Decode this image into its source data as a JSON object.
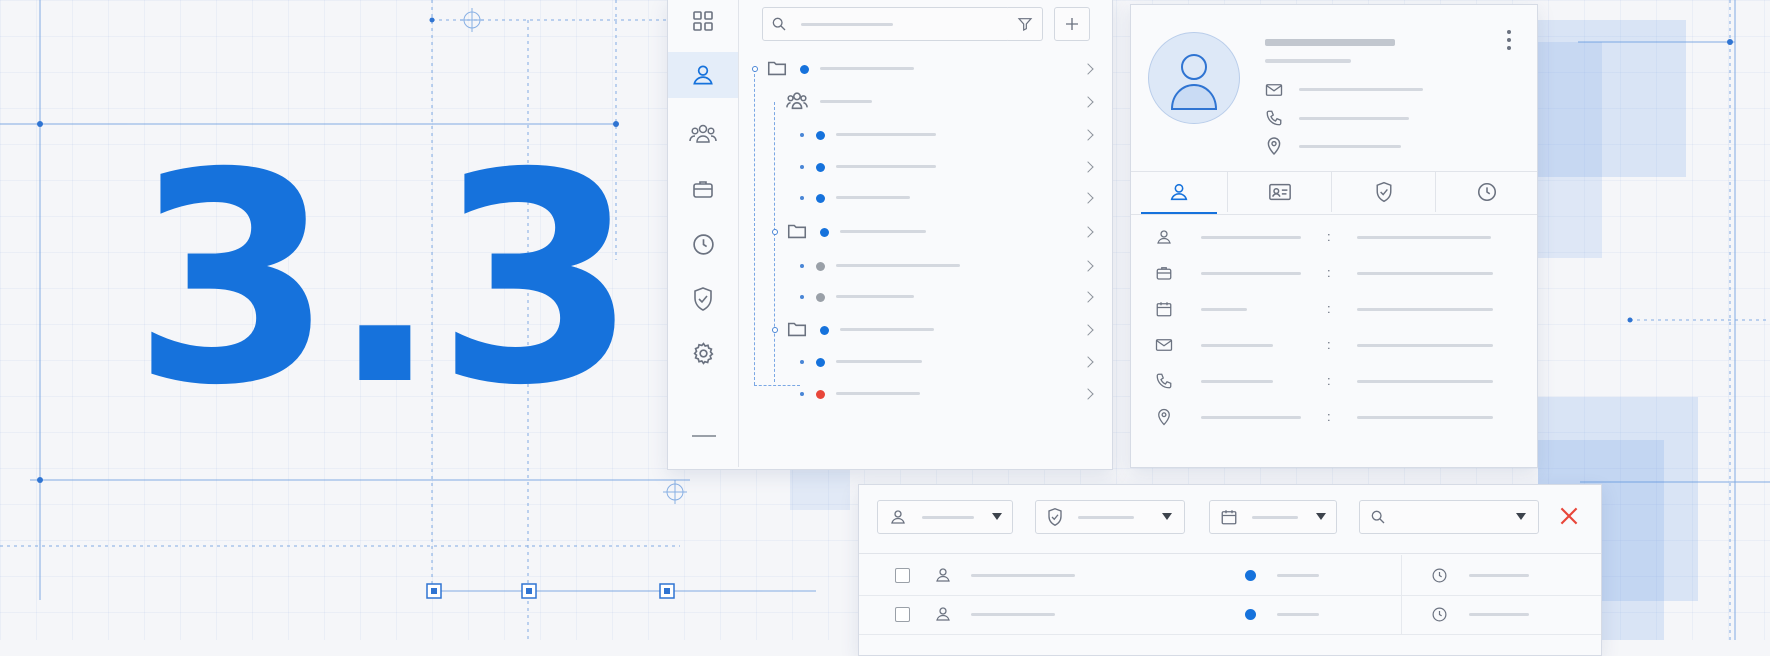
{
  "hero": {
    "version": "3.3"
  },
  "colors": {
    "accent": "#1672dc",
    "muted_dot": "#9aa0a8",
    "alert_dot": "#e8463a",
    "close": "#e8463a",
    "line": "#d4d8df"
  },
  "sidebar": {
    "items": [
      {
        "icon": "grid-icon"
      },
      {
        "icon": "user-icon",
        "active": true
      },
      {
        "icon": "users-icon"
      },
      {
        "icon": "briefcase-icon"
      },
      {
        "icon": "clock-icon"
      },
      {
        "icon": "shield-check-icon"
      },
      {
        "icon": "gear-icon"
      },
      {
        "icon": "minus-icon"
      }
    ]
  },
  "tree_toolbar": {
    "search_icon": "search-icon",
    "filter_icon": "filter-icon",
    "add_icon": "plus-icon"
  },
  "tree": {
    "nodes": [
      {
        "kind": "folder",
        "level": 0,
        "dot": "blue"
      },
      {
        "kind": "group",
        "level": 1,
        "dot": "none"
      },
      {
        "kind": "item",
        "level": 2,
        "dot": "blue"
      },
      {
        "kind": "item",
        "level": 2,
        "dot": "blue"
      },
      {
        "kind": "item",
        "level": 2,
        "dot": "blue"
      },
      {
        "kind": "folder",
        "level": 1,
        "dot": "blue"
      },
      {
        "kind": "item",
        "level": 2,
        "dot": "gray"
      },
      {
        "kind": "item",
        "level": 2,
        "dot": "gray"
      },
      {
        "kind": "folder",
        "level": 1,
        "dot": "blue"
      },
      {
        "kind": "item",
        "level": 2,
        "dot": "blue"
      },
      {
        "kind": "item",
        "level": 2,
        "dot": "red"
      }
    ]
  },
  "profile": {
    "avatar_icon": "user-avatar-icon",
    "contact_icons": [
      "mail-icon",
      "phone-icon",
      "location-icon"
    ],
    "tabs": [
      {
        "icon": "user-icon",
        "active": true
      },
      {
        "icon": "id-card-icon"
      },
      {
        "icon": "shield-check-icon"
      },
      {
        "icon": "clock-icon"
      }
    ],
    "detail_rows": [
      {
        "icon": "user-icon"
      },
      {
        "icon": "briefcase-icon"
      },
      {
        "icon": "calendar-icon"
      },
      {
        "icon": "mail-icon"
      },
      {
        "icon": "phone-icon"
      },
      {
        "icon": "location-icon"
      }
    ],
    "separator": ":"
  },
  "filters": {
    "dropdowns": [
      {
        "icon": "user-icon"
      },
      {
        "icon": "shield-check-icon"
      },
      {
        "icon": "calendar-icon"
      },
      {
        "icon": "search-icon"
      }
    ],
    "close_icon": "close-x-icon"
  },
  "results": {
    "rows": [
      {
        "checked": false,
        "dot": "blue"
      },
      {
        "checked": false,
        "dot": "blue"
      }
    ]
  }
}
